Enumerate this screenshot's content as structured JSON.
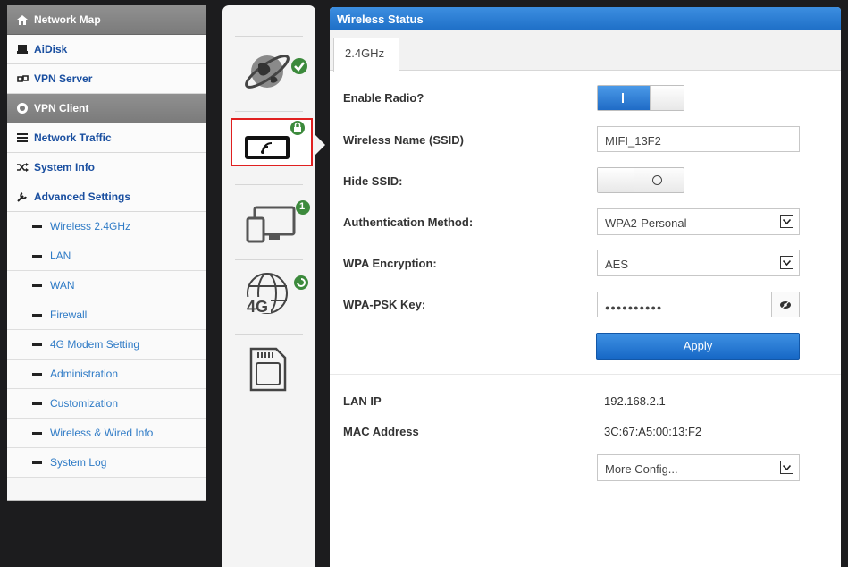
{
  "sidebar": {
    "main_items": [
      {
        "label": "Network Map",
        "icon": "home-icon"
      },
      {
        "label": "AiDisk",
        "icon": "disk-icon"
      },
      {
        "label": "VPN Server",
        "icon": "vpn-server-icon"
      },
      {
        "label": "VPN Client",
        "icon": "vpn-client-icon"
      },
      {
        "label": "Network Traffic",
        "icon": "traffic-icon"
      },
      {
        "label": "System Info",
        "icon": "shuffle-icon"
      },
      {
        "label": "Advanced Settings",
        "icon": "wrench-icon"
      }
    ],
    "sub_items": [
      "Wireless 2.4GHz",
      "LAN",
      "WAN",
      "Firewall",
      "4G Modem Setting",
      "Administration",
      "Customization",
      "Wireless & Wired Info",
      "System Log"
    ]
  },
  "iconbar": {
    "badges": {
      "clients_count": "1"
    },
    "sim_label": "4G"
  },
  "panel": {
    "title": "Wireless Status",
    "tab": "2.4GHz",
    "fields": {
      "enable_radio": {
        "label": "Enable Radio?",
        "on_symbol": "I",
        "state": "on"
      },
      "ssid": {
        "label": "Wireless Name (SSID)",
        "value": "MIFI_13F2"
      },
      "hide_ssid": {
        "label": "Hide SSID:",
        "state": "off"
      },
      "auth": {
        "label": "Authentication Method:",
        "value": "WPA2-Personal"
      },
      "encryption": {
        "label": "WPA Encryption:",
        "value": "AES"
      },
      "psk": {
        "label": "WPA-PSK Key:",
        "value": "●●●●●●●●●●"
      }
    },
    "apply_label": "Apply",
    "info": {
      "lan_ip_label": "LAN IP",
      "lan_ip_value": "192.168.2.1",
      "mac_label": "MAC Address",
      "mac_value": "3C:67:A5:00:13:F2"
    },
    "more_config": "More Config..."
  },
  "colors": {
    "accent": "#1e6fc7",
    "link": "#2f7bc6",
    "badge_green": "#3c8a3c",
    "highlight_red": "#e02020"
  }
}
